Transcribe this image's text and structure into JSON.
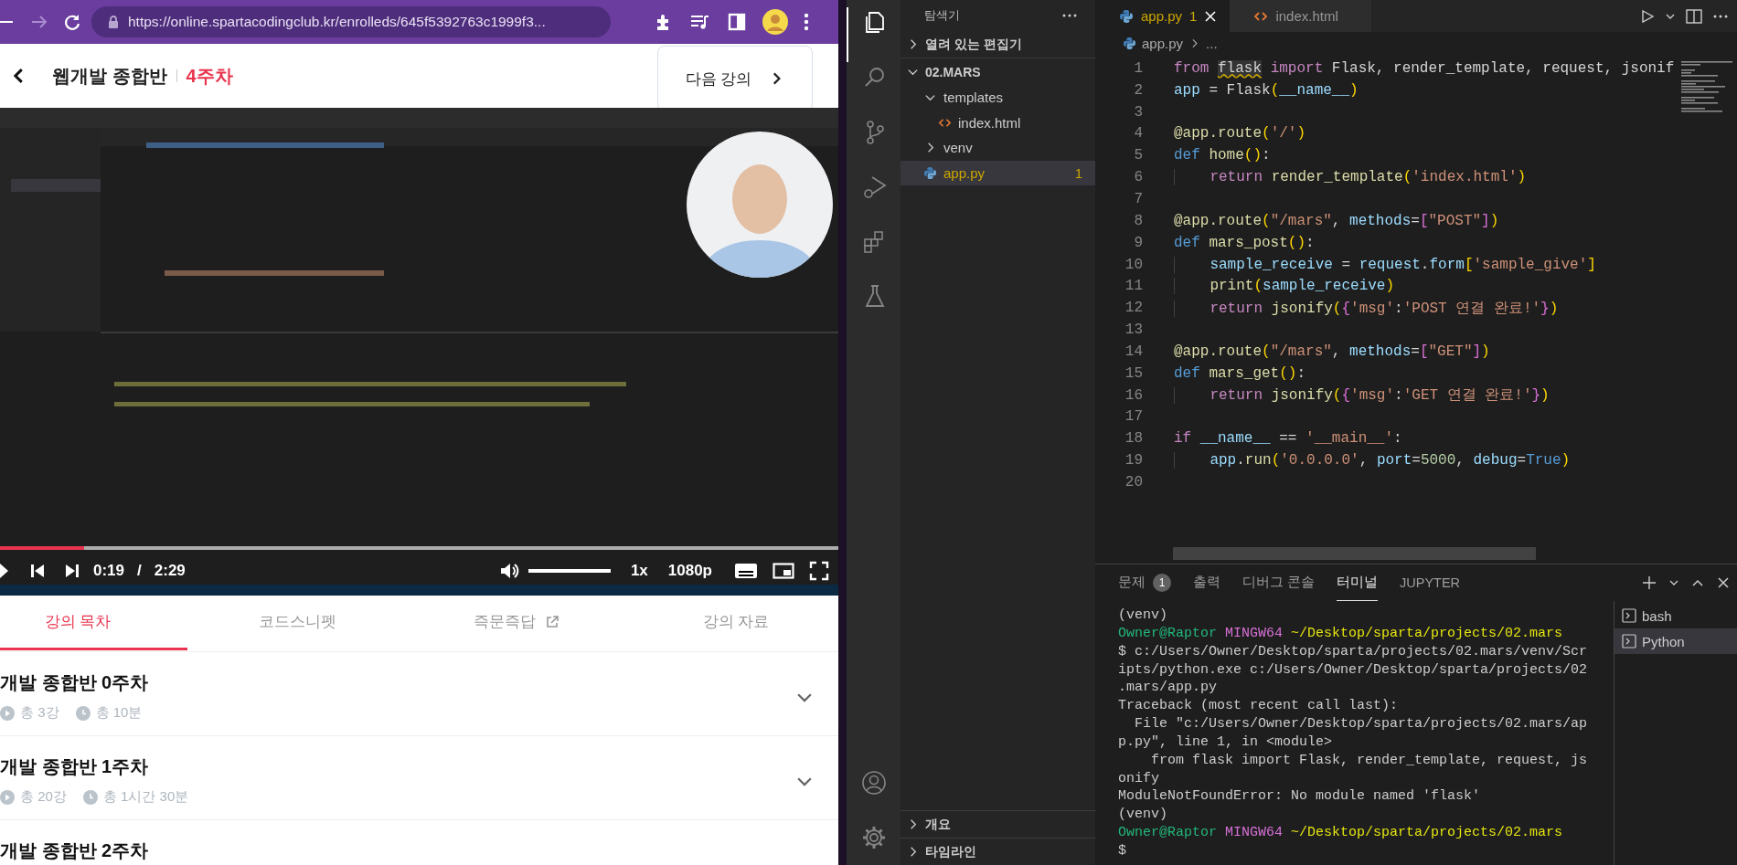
{
  "browser": {
    "url": "https://online.spartacodingclub.kr/enrolleds/645f5392763c1999f3..."
  },
  "course_header": {
    "title": "웹개발 종합반",
    "week": "4주차",
    "next_button": "다음 강의"
  },
  "video": {
    "kind": "picture",
    "progress": {
      "level": 0.1
    },
    "current_time": "0:19",
    "separator": "/",
    "duration": "2:29",
    "volume": {
      "level": 1
    },
    "speed": "1x",
    "quality": "1080p"
  },
  "course_tabs": [
    {
      "label": "강의 목차",
      "selected": true,
      "external": false
    },
    {
      "label": "코드스니펫",
      "selected": false,
      "external": false
    },
    {
      "label": "즉문즉답",
      "selected": false,
      "external": true
    },
    {
      "label": "강의 자료",
      "selected": false,
      "external": false
    }
  ],
  "weeks": [
    {
      "title": "개발 종합반 0주차",
      "lessons": "총 3강",
      "duration": "총 10분",
      "expanded": false
    },
    {
      "title": "개발 종합반 1주차",
      "lessons": "총 20강",
      "duration": "총 1시간 30분",
      "expanded": false
    },
    {
      "title": "개발 종합반 2주차"
    }
  ],
  "vscode": {
    "activity_bar": [
      {
        "kind": "explorer",
        "selected": true
      },
      {
        "kind": "search",
        "selected": false
      },
      {
        "kind": "source-control",
        "selected": false
      },
      {
        "kind": "run-debug",
        "selected": false
      },
      {
        "kind": "extensions",
        "selected": false
      },
      {
        "kind": "testing",
        "selected": false
      }
    ],
    "activity_bottom": [
      {
        "kind": "account"
      },
      {
        "kind": "settings"
      }
    ],
    "sidebar": {
      "title": "탐색기",
      "open_editors": {
        "label": "열려 있는 편집기",
        "expanded": false
      },
      "folder": {
        "label": "02.MARS",
        "expanded": true,
        "children": [
          {
            "label": "templates",
            "kind": "folder",
            "expanded": true,
            "selected": false,
            "children": [
              {
                "label": "index.html",
                "kind": "html",
                "selected": false
              }
            ]
          },
          {
            "label": "venv",
            "kind": "folder",
            "expanded": false,
            "selected": false
          },
          {
            "label": "app.py",
            "kind": "python",
            "selected": true,
            "badge": "1"
          }
        ]
      },
      "bottom_sections": [
        {
          "label": "개요",
          "expanded": false
        },
        {
          "label": "타임라인",
          "expanded": false
        }
      ]
    },
    "editor": {
      "tabs": [
        {
          "label": "app.py",
          "kind": "python",
          "selected": true,
          "badge": "1"
        },
        {
          "label": "index.html",
          "kind": "html",
          "selected": false
        }
      ],
      "breadcrumb": {
        "file": "app.py",
        "rest": "..."
      },
      "lines": [
        {
          "number": "1",
          "tokens": [
            {
              "text": "from ",
              "kind": "kw"
            },
            {
              "text": "flask",
              "kind": "warn"
            },
            {
              "text": " import",
              "kind": "kw"
            },
            {
              "text": " Flask, render_template, request, jsonif",
              "kind": "p"
            }
          ]
        },
        {
          "number": "2",
          "tokens": [
            {
              "text": "app",
              "kind": "var"
            },
            {
              "text": " = Flask",
              "kind": "p"
            },
            {
              "text": "(",
              "kind": "b1"
            },
            {
              "text": "__name__",
              "kind": "var"
            },
            {
              "text": ")",
              "kind": "b1"
            }
          ]
        },
        {
          "number": "3"
        },
        {
          "number": "4",
          "tokens": [
            {
              "text": "@app.route",
              "kind": "fn"
            },
            {
              "text": "(",
              "kind": "b1"
            },
            {
              "text": "'/'",
              "kind": "str"
            },
            {
              "text": ")",
              "kind": "b1"
            }
          ]
        },
        {
          "number": "5",
          "tokens": [
            {
              "text": "def ",
              "kind": "store"
            },
            {
              "text": "home",
              "kind": "fn"
            },
            {
              "text": "()",
              "kind": "b1"
            },
            {
              "text": ":",
              "kind": "p"
            }
          ]
        },
        {
          "number": "6",
          "tokens": [
            {
              "text": "    return ",
              "kind": "kw"
            },
            {
              "text": "render_template",
              "kind": "fn"
            },
            {
              "text": "(",
              "kind": "b1"
            },
            {
              "text": "'index.html'",
              "kind": "str"
            },
            {
              "text": ")",
              "kind": "b1"
            }
          ]
        },
        {
          "number": "7"
        },
        {
          "number": "8",
          "tokens": [
            {
              "text": "@app.route",
              "kind": "fn"
            },
            {
              "text": "(",
              "kind": "b1"
            },
            {
              "text": "\"/mars\"",
              "kind": "str"
            },
            {
              "text": ", ",
              "kind": "p"
            },
            {
              "text": "methods",
              "kind": "var"
            },
            {
              "text": "=",
              "kind": "p"
            },
            {
              "text": "[",
              "kind": "b2"
            },
            {
              "text": "\"POST\"",
              "kind": "str"
            },
            {
              "text": "]",
              "kind": "b2"
            },
            {
              "text": ")",
              "kind": "b1"
            }
          ]
        },
        {
          "number": "9",
          "tokens": [
            {
              "text": "def ",
              "kind": "store"
            },
            {
              "text": "mars_post",
              "kind": "fn"
            },
            {
              "text": "()",
              "kind": "b1"
            },
            {
              "text": ":",
              "kind": "p"
            }
          ]
        },
        {
          "number": "10",
          "tokens": [
            {
              "text": "    sample_receive",
              "kind": "var"
            },
            {
              "text": " = ",
              "kind": "p"
            },
            {
              "text": "request",
              "kind": "var"
            },
            {
              "text": ".",
              "kind": "p"
            },
            {
              "text": "form",
              "kind": "var"
            },
            {
              "text": "[",
              "kind": "b1"
            },
            {
              "text": "'sample_give'",
              "kind": "str"
            },
            {
              "text": "]",
              "kind": "b1"
            }
          ]
        },
        {
          "number": "11",
          "tokens": [
            {
              "text": "    print",
              "kind": "fn"
            },
            {
              "text": "(",
              "kind": "b1"
            },
            {
              "text": "sample_receive",
              "kind": "var"
            },
            {
              "text": ")",
              "kind": "b1"
            }
          ]
        },
        {
          "number": "12",
          "tokens": [
            {
              "text": "    return ",
              "kind": "kw"
            },
            {
              "text": "jsonify",
              "kind": "fn"
            },
            {
              "text": "(",
              "kind": "b1"
            },
            {
              "text": "{",
              "kind": "b2"
            },
            {
              "text": "'msg'",
              "kind": "str"
            },
            {
              "text": ":",
              "kind": "p"
            },
            {
              "text": "'POST 연결 완료!'",
              "kind": "str"
            },
            {
              "text": "}",
              "kind": "b2"
            },
            {
              "text": ")",
              "kind": "b1"
            }
          ]
        },
        {
          "number": "13"
        },
        {
          "number": "14",
          "tokens": [
            {
              "text": "@app.route",
              "kind": "fn"
            },
            {
              "text": "(",
              "kind": "b1"
            },
            {
              "text": "\"/mars\"",
              "kind": "str"
            },
            {
              "text": ", ",
              "kind": "p"
            },
            {
              "text": "methods",
              "kind": "var"
            },
            {
              "text": "=",
              "kind": "p"
            },
            {
              "text": "[",
              "kind": "b2"
            },
            {
              "text": "\"GET\"",
              "kind": "str"
            },
            {
              "text": "]",
              "kind": "b2"
            },
            {
              "text": ")",
              "kind": "b1"
            }
          ]
        },
        {
          "number": "15",
          "tokens": [
            {
              "text": "def ",
              "kind": "store"
            },
            {
              "text": "mars_get",
              "kind": "fn"
            },
            {
              "text": "()",
              "kind": "b1"
            },
            {
              "text": ":",
              "kind": "p"
            }
          ]
        },
        {
          "number": "16",
          "tokens": [
            {
              "text": "    return ",
              "kind": "kw"
            },
            {
              "text": "jsonify",
              "kind": "fn"
            },
            {
              "text": "(",
              "kind": "b1"
            },
            {
              "text": "{",
              "kind": "b2"
            },
            {
              "text": "'msg'",
              "kind": "str"
            },
            {
              "text": ":",
              "kind": "p"
            },
            {
              "text": "'GET 연결 완료!'",
              "kind": "str"
            },
            {
              "text": "}",
              "kind": "b2"
            },
            {
              "text": ")",
              "kind": "b1"
            }
          ]
        },
        {
          "number": "17"
        },
        {
          "number": "18",
          "tokens": [
            {
              "text": "if ",
              "kind": "kw"
            },
            {
              "text": "__name__",
              "kind": "var"
            },
            {
              "text": " == ",
              "kind": "p"
            },
            {
              "text": "'__main__'",
              "kind": "str"
            },
            {
              "text": ":",
              "kind": "p"
            }
          ]
        },
        {
          "number": "19",
          "tokens": [
            {
              "text": "    app",
              "kind": "var"
            },
            {
              "text": ".",
              "kind": "p"
            },
            {
              "text": "run",
              "kind": "fn"
            },
            {
              "text": "(",
              "kind": "b1"
            },
            {
              "text": "'0.0.0.0'",
              "kind": "str"
            },
            {
              "text": ", ",
              "kind": "p"
            },
            {
              "text": "port",
              "kind": "var"
            },
            {
              "text": "=",
              "kind": "p"
            },
            {
              "text": "5000",
              "kind": "num"
            },
            {
              "text": ", ",
              "kind": "p"
            },
            {
              "text": "debug",
              "kind": "var"
            },
            {
              "text": "=",
              "kind": "p"
            },
            {
              "text": "True",
              "kind": "store"
            },
            {
              "text": ")",
              "kind": "b1"
            }
          ]
        },
        {
          "number": "20"
        }
      ]
    },
    "panel": {
      "tabs": [
        {
          "label": "문제",
          "badge": "1",
          "selected": false
        },
        {
          "label": "출력",
          "selected": false
        },
        {
          "label": "디버그 콘솔",
          "selected": false
        },
        {
          "label": "터미널",
          "selected": true
        },
        {
          "label": "JUPYTER",
          "selected": false
        }
      ],
      "terminal": [
        [
          {
            "text": "(venv)",
            "kind": "text"
          }
        ],
        [
          {
            "text": "Owner@Raptor ",
            "kind": "user"
          },
          {
            "text": "MINGW64 ",
            "kind": "host"
          },
          {
            "text": "~/Desktop/sparta/projects/02.mars",
            "kind": "path"
          }
        ],
        [
          {
            "text": "$ c:/Users/Owner/Desktop/sparta/projects/02.mars/venv/Scr",
            "kind": "text"
          }
        ],
        [
          {
            "text": "ipts/python.exe c:/Users/Owner/Desktop/sparta/projects/02",
            "kind": "text"
          }
        ],
        [
          {
            "text": ".mars/app.py",
            "kind": "text"
          }
        ],
        [
          {
            "text": "Traceback (most recent call last):",
            "kind": "text"
          }
        ],
        [
          {
            "text": "  File \"c:/Users/Owner/Desktop/sparta/projects/02.mars/ap",
            "kind": "text"
          }
        ],
        [
          {
            "text": "p.py\", line 1, in <module>",
            "kind": "text"
          }
        ],
        [
          {
            "text": "    from flask import Flask, render_template, request, js",
            "kind": "text"
          }
        ],
        [
          {
            "text": "onify",
            "kind": "text"
          }
        ],
        [
          {
            "text": "ModuleNotFoundError: No module named 'flask'",
            "kind": "text"
          }
        ],
        [
          {
            "text": "(venv)",
            "kind": "text"
          }
        ],
        [
          {
            "text": "Owner@Raptor ",
            "kind": "user"
          },
          {
            "text": "MINGW64 ",
            "kind": "host"
          },
          {
            "text": "~/Desktop/sparta/projects/02.mars",
            "kind": "path"
          }
        ],
        [
          {
            "text": "$",
            "kind": "text"
          }
        ]
      ],
      "terminals": [
        {
          "label": "bash",
          "selected": false
        },
        {
          "label": "Python",
          "selected": true
        }
      ]
    }
  }
}
